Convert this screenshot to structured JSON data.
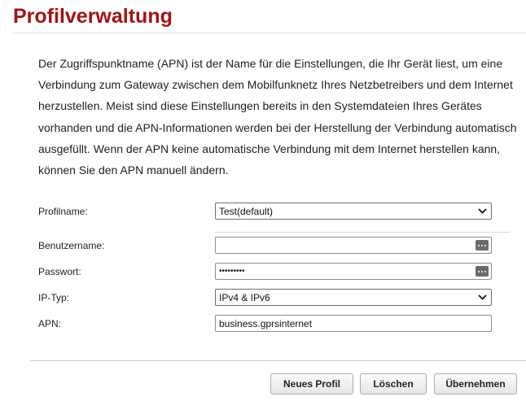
{
  "page": {
    "title": "Profilverwaltung",
    "description": "Der Zugriffspunktname (APN) ist der Name für die Einstellungen, die Ihr Gerät liest, um eine Verbindung zum Gateway zwischen dem Mobilfunknetz Ihres Netzbetreibers und dem Internet herzustellen. Meist sind diese Einstellungen bereits in den Systemdateien Ihres Gerätes vorhanden und die APN-Informationen werden bei der Herstellung der Verbindung automatisch ausgefüllt. Wenn der APN keine automatische Verbindung mit dem Internet herstellen kann, können Sie den APN manuell ändern."
  },
  "form": {
    "profile_name": {
      "label": "Profilname:",
      "value": "Test(default)"
    },
    "username": {
      "label": "Benutzername:",
      "value": ""
    },
    "password": {
      "label": "Passwort:",
      "value": "•••••••••"
    },
    "ip_type": {
      "label": "IP-Typ:",
      "value": "IPv4 & IPv6"
    },
    "apn": {
      "label": "APN:",
      "value": "business.gprsinternet"
    }
  },
  "buttons": {
    "new_profile": "Neues Profil",
    "delete": "Löschen",
    "apply": "Übernehmen"
  },
  "colors": {
    "title": "#a31313"
  },
  "icons": {
    "dropdown": "chevron-down-icon",
    "password_manager": "key-dots-icon"
  }
}
